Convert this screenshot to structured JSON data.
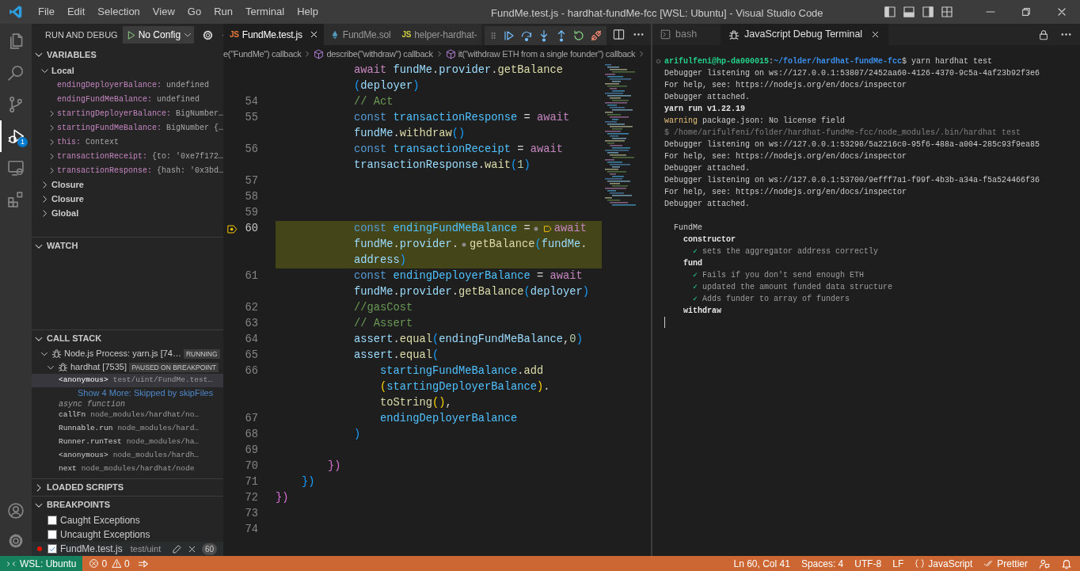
{
  "title_bar": {
    "menus": [
      "File",
      "Edit",
      "Selection",
      "View",
      "Go",
      "Run",
      "Terminal",
      "Help"
    ],
    "title": "FundMe.test.js - hardhat-fundMe-fcc [WSL: Ubuntu] - Visual Studio Code"
  },
  "activity_bar": {
    "items": [
      {
        "kind": "explorer",
        "selected": false
      },
      {
        "kind": "search",
        "selected": false
      },
      {
        "kind": "source-control",
        "selected": false
      },
      {
        "kind": "run-debug",
        "selected": true,
        "badge": "1"
      },
      {
        "kind": "remote",
        "selected": false
      },
      {
        "kind": "extensions",
        "selected": false
      }
    ],
    "bottom": [
      {
        "kind": "account"
      },
      {
        "kind": "settings"
      }
    ]
  },
  "run_and_debug": {
    "title": "RUN AND DEBUG",
    "configuration": "No Config"
  },
  "variables": {
    "title": "VARIABLES",
    "expanded": true,
    "scopes": [
      {
        "label": "Local",
        "expanded": true,
        "children": [
          {
            "name": "endingDeployerBalance:",
            "value": "undefined",
            "expandable": false
          },
          {
            "name": "endingFundMeBalance:",
            "value": "undefined",
            "expandable": false
          },
          {
            "name": "startingDeployerBalance:",
            "value": "BigNumber…",
            "expandable": true
          },
          {
            "name": "startingFundMeBalance:",
            "value": "BigNumber {…",
            "expandable": true
          },
          {
            "name": "this:",
            "value": "Context",
            "expandable": true
          },
          {
            "name": "transactionReceipt:",
            "value": "{to: '0xe7f172…",
            "expandable": true
          },
          {
            "name": "transactionResponse:",
            "value": "{hash: '0x3bd…",
            "expandable": true
          }
        ]
      },
      {
        "label": "Closure",
        "expanded": false
      },
      {
        "label": "Closure",
        "expanded": false
      },
      {
        "label": "Global",
        "expanded": false
      }
    ]
  },
  "watch": {
    "title": "WATCH",
    "expanded": true
  },
  "call_stack": {
    "title": "CALL STACK",
    "expanded": true,
    "sessions": [
      {
        "label": "Node.js Process: yarn.js [74…",
        "badge": "RUNNING",
        "expanded": true,
        "children": [
          {
            "label": "hardhat [7535]",
            "badge": "PAUSED ON BREAKPOINT",
            "expanded": true,
            "frames": [
              {
                "kind": "frame",
                "name": "<anonymous>",
                "source": "test/uint/FundMe.test…",
                "selected": true
              },
              {
                "kind": "link",
                "text": "Show 4 More: Skipped by skipFiles"
              },
              {
                "kind": "label",
                "text": "async function"
              },
              {
                "kind": "frame",
                "name": "callFn",
                "source": "node_modules/hardhat/no…",
                "selected": false
              },
              {
                "kind": "frame",
                "name": "Runnable.run",
                "source": "node_modules/hard…",
                "selected": false
              },
              {
                "kind": "frame",
                "name": "Runner.runTest",
                "source": "node_modules/ha…",
                "selected": false
              },
              {
                "kind": "frame",
                "name": "<anonymous>",
                "source": "node_modules/hardh…",
                "selected": false
              },
              {
                "kind": "frame",
                "name": "next",
                "source": "node_modules/hardhat/node",
                "selected": false
              }
            ]
          }
        ]
      }
    ]
  },
  "loaded_scripts": {
    "title": "LOADED SCRIPTS",
    "expanded": false
  },
  "breakpoints": {
    "title": "BREAKPOINTS",
    "expanded": true,
    "items": [
      {
        "kind": "exception",
        "label": "Caught Exceptions",
        "checked": false
      },
      {
        "kind": "exception",
        "label": "Uncaught Exceptions",
        "checked": false
      },
      {
        "kind": "file",
        "label": "FundMe.test.js",
        "path": "test/uint",
        "checked": true,
        "line": "60"
      }
    ]
  },
  "editor": {
    "tabs": [
      {
        "kind": "js",
        "icon_text": "JS",
        "color": "#e8793a",
        "label": "FundMe.test.js",
        "selected": true
      },
      {
        "kind": "sol",
        "label": "FundMe.sol",
        "selected": false
      },
      {
        "kind": "js",
        "icon_text": "JS",
        "color": "#cbcb41",
        "label": "helper-hardhat-",
        "selected": false
      }
    ],
    "breadcrumb": [
      {
        "text": "e(\"FundMe\") callback",
        "icon": false
      },
      {
        "text": "describe(\"withdraw\") callback",
        "icon": true
      },
      {
        "text": "it(\"withdraw ETH from a single founder\") callback",
        "icon": true
      }
    ],
    "rows": [
      {
        "children": [
          {
            "children": [
              {
                "children": [
                  {
                    "paused": false,
                    "breakpoint": false,
                    "tokens": [
                      {
                        "kind": "ctl",
                        "text": "await "
                      },
                      {
                        "kind": "prop",
                        "text": "fundMe"
                      },
                      {
                        "kind": "p",
                        "text": "."
                      },
                      {
                        "kind": "prop",
                        "text": "provider"
                      },
                      {
                        "kind": "p",
                        "text": "."
                      },
                      {
                        "kind": "fn",
                        "text": "getBalance"
                      }
                    ]
                  },
                  {
                    "paused": false,
                    "breakpoint": false,
                    "tokens": [
                      {
                        "kind": "b3",
                        "text": "("
                      },
                      {
                        "kind": "prop",
                        "text": "deployer"
                      },
                      {
                        "kind": "b3",
                        "text": ")"
                      }
                    ]
                  },
                  {
                    "line": "54",
                    "paused": false,
                    "breakpoint": false,
                    "tokens": [
                      {
                        "kind": "cm",
                        "text": "// Act"
                      }
                    ]
                  },
                  {
                    "line": "55",
                    "paused": false,
                    "breakpoint": false,
                    "tokens": [
                      {
                        "kind": "kw",
                        "text": "const "
                      },
                      {
                        "kind": "var",
                        "text": "transactionResponse"
                      },
                      {
                        "kind": "p",
                        "text": " = "
                      },
                      {
                        "kind": "ctl",
                        "text": "await"
                      }
                    ]
                  },
                  {
                    "paused": false,
                    "breakpoint": false,
                    "tokens": [
                      {
                        "kind": "prop",
                        "text": "fundMe"
                      },
                      {
                        "kind": "p",
                        "text": "."
                      },
                      {
                        "kind": "fn",
                        "text": "withdraw"
                      },
                      {
                        "kind": "b3",
                        "text": "()"
                      }
                    ]
                  },
                  {
                    "line": "56",
                    "paused": false,
                    "breakpoint": false,
                    "tokens": [
                      {
                        "kind": "kw",
                        "text": "const "
                      },
                      {
                        "kind": "var",
                        "text": "transactionReceipt"
                      },
                      {
                        "kind": "p",
                        "text": " = "
                      },
                      {
                        "kind": "ctl",
                        "text": "await"
                      }
                    ]
                  },
                  {
                    "paused": false,
                    "breakpoint": false,
                    "tokens": [
                      {
                        "kind": "prop",
                        "text": "transactionResponse"
                      },
                      {
                        "kind": "p",
                        "text": "."
                      },
                      {
                        "kind": "fn",
                        "text": "wait"
                      },
                      {
                        "kind": "b3",
                        "text": "("
                      },
                      {
                        "kind": "num",
                        "text": "1"
                      },
                      {
                        "kind": "b3",
                        "text": ")"
                      }
                    ]
                  },
                  {
                    "line": "57",
                    "paused": false,
                    "breakpoint": false
                  },
                  {
                    "line": "58",
                    "paused": false,
                    "breakpoint": false
                  },
                  {
                    "line": "59",
                    "paused": false,
                    "breakpoint": false
                  },
                  {
                    "line": "60",
                    "paused": true,
                    "breakpoint": true,
                    "tokens": [
                      {
                        "kind": "kw",
                        "text": "const "
                      },
                      {
                        "kind": "var",
                        "text": "endingFundMeBalance"
                      },
                      {
                        "kind": "p",
                        "text": " ="
                      },
                      {
                        "kind": "bp"
                      },
                      {
                        "kind": "stop"
                      },
                      {
                        "kind": "ctl",
                        "text": "await"
                      }
                    ]
                  },
                  {
                    "paused": true,
                    "breakpoint": false,
                    "tokens": [
                      {
                        "kind": "prop",
                        "text": "fundMe"
                      },
                      {
                        "kind": "p",
                        "text": "."
                      },
                      {
                        "kind": "prop",
                        "text": "provider"
                      },
                      {
                        "kind": "p",
                        "text": "."
                      },
                      {
                        "kind": "bp"
                      },
                      {
                        "kind": "fn",
                        "text": "getBalance"
                      },
                      {
                        "kind": "b3",
                        "text": "("
                      },
                      {
                        "kind": "prop",
                        "text": "fundMe"
                      },
                      {
                        "kind": "p",
                        "text": "."
                      }
                    ]
                  },
                  {
                    "paused": true,
                    "breakpoint": false,
                    "tokens": [
                      {
                        "kind": "prop",
                        "text": "address"
                      },
                      {
                        "kind": "b3",
                        "text": ")"
                      }
                    ]
                  },
                  {
                    "line": "61",
                    "paused": false,
                    "breakpoint": false,
                    "tokens": [
                      {
                        "kind": "kw",
                        "text": "const "
                      },
                      {
                        "kind": "var",
                        "text": "endingDeployerBalance"
                      },
                      {
                        "kind": "p",
                        "text": " = "
                      },
                      {
                        "kind": "ctl",
                        "text": "await"
                      }
                    ]
                  },
                  {
                    "paused": false,
                    "breakpoint": false,
                    "tokens": [
                      {
                        "kind": "prop",
                        "text": "fundMe"
                      },
                      {
                        "kind": "p",
                        "text": "."
                      },
                      {
                        "kind": "prop",
                        "text": "provider"
                      },
                      {
                        "kind": "p",
                        "text": "."
                      },
                      {
                        "kind": "fn",
                        "text": "getBalance"
                      },
                      {
                        "kind": "b3",
                        "text": "("
                      },
                      {
                        "kind": "prop",
                        "text": "deployer"
                      },
                      {
                        "kind": "b3",
                        "text": ")"
                      }
                    ]
                  },
                  {
                    "line": "62",
                    "paused": false,
                    "breakpoint": false,
                    "tokens": [
                      {
                        "kind": "cm",
                        "text": "//gasCost"
                      }
                    ]
                  },
                  {
                    "line": "63",
                    "paused": false,
                    "breakpoint": false,
                    "tokens": [
                      {
                        "kind": "cm",
                        "text": "// Assert"
                      }
                    ]
                  },
                  {
                    "line": "64",
                    "paused": false,
                    "breakpoint": false,
                    "tokens": [
                      {
                        "kind": "prop",
                        "text": "assert"
                      },
                      {
                        "kind": "p",
                        "text": "."
                      },
                      {
                        "kind": "fn",
                        "text": "equal"
                      },
                      {
                        "kind": "b3",
                        "text": "("
                      },
                      {
                        "kind": "prop",
                        "text": "endingFundMeBalance"
                      },
                      {
                        "kind": "p",
                        "text": ","
                      },
                      {
                        "kind": "num",
                        "text": "0"
                      },
                      {
                        "kind": "b3",
                        "text": ")"
                      }
                    ]
                  },
                  {
                    "line": "65",
                    "paused": false,
                    "breakpoint": false,
                    "tokens": [
                      {
                        "kind": "prop",
                        "text": "assert"
                      },
                      {
                        "kind": "p",
                        "text": "."
                      },
                      {
                        "kind": "fn",
                        "text": "equal"
                      },
                      {
                        "kind": "b3",
                        "text": "("
                      }
                    ],
                    "children": [
                      {
                        "line": "66",
                        "paused": false,
                        "breakpoint": false,
                        "tokens": [
                          {
                            "kind": "var",
                            "text": "startingFundMeBalance"
                          },
                          {
                            "kind": "p",
                            "text": "."
                          },
                          {
                            "kind": "fn",
                            "text": "add"
                          }
                        ]
                      },
                      {
                        "paused": false,
                        "breakpoint": false,
                        "tokens": [
                          {
                            "kind": "b1",
                            "text": "("
                          },
                          {
                            "kind": "var",
                            "text": "startingDeployerBalance"
                          },
                          {
                            "kind": "b1",
                            "text": ")"
                          },
                          {
                            "kind": "p",
                            "text": "."
                          }
                        ]
                      },
                      {
                        "paused": false,
                        "breakpoint": false,
                        "tokens": [
                          {
                            "kind": "fn",
                            "text": "toString"
                          },
                          {
                            "kind": "b1",
                            "text": "()"
                          },
                          {
                            "kind": "p",
                            "text": ","
                          }
                        ]
                      },
                      {
                        "line": "67",
                        "paused": false,
                        "breakpoint": false,
                        "tokens": [
                          {
                            "kind": "var",
                            "text": "endingDeployerBalance"
                          }
                        ]
                      }
                    ]
                  },
                  {
                    "line": "68",
                    "paused": false,
                    "breakpoint": false,
                    "tokens": [
                      {
                        "kind": "b3",
                        "text": ")"
                      }
                    ]
                  },
                  {
                    "line": "69",
                    "paused": false,
                    "breakpoint": false
                  }
                ]
              },
              {
                "line": "70",
                "paused": false,
                "breakpoint": false,
                "tokens": [
                  {
                    "kind": "b2",
                    "text": "}"
                  },
                  {
                    "kind": "b2",
                    "text": ")"
                  }
                ]
              }
            ]
          },
          {
            "line": "71",
            "paused": false,
            "breakpoint": false,
            "tokens": [
              {
                "kind": "b3",
                "text": "}"
              },
              {
                "kind": "b3",
                "text": ")"
              }
            ]
          }
        ]
      },
      {
        "line": "72",
        "paused": false,
        "breakpoint": false,
        "tokens": [
          {
            "kind": "b2",
            "text": "}"
          },
          {
            "kind": "b2",
            "text": ")"
          }
        ]
      },
      {
        "line": "73",
        "paused": false,
        "breakpoint": false
      },
      {
        "line": "74",
        "paused": false,
        "breakpoint": false
      }
    ]
  },
  "terminal": {
    "tabs": [
      {
        "kind": "shell",
        "label": "bash",
        "selected": false
      },
      {
        "kind": "debug",
        "label": "JavaScript Debug Terminal",
        "selected": true
      }
    ],
    "lines": [
      {
        "tokens": [
          {
            "kind": "marker"
          },
          {
            "kind": "user",
            "text": "arifulfeni@hp-da000015"
          },
          {
            "kind": "plain",
            "text": ":"
          },
          {
            "kind": "path",
            "text": "~/folder/hardhat-fundMe-fcc"
          },
          {
            "kind": "plain",
            "text": "$ yarn hardhat test"
          }
        ]
      },
      {
        "tokens": [
          {
            "kind": "plain",
            "text": "Debugger listening on ws://127.0.0.1:53807/2452aa60-4126-4370-9c5a-4af23b92f3e6"
          }
        ]
      },
      {
        "tokens": [
          {
            "kind": "plain",
            "text": "For help, see: https://nodejs.org/en/docs/inspector"
          }
        ]
      },
      {
        "tokens": [
          {
            "kind": "plain",
            "text": "Debugger attached."
          }
        ]
      },
      {
        "tokens": [
          {
            "kind": "bold",
            "text": "yarn run v1.22.19"
          }
        ]
      },
      {
        "tokens": [
          {
            "kind": "warn",
            "text": "warning"
          },
          {
            "kind": "plain",
            "text": " package.json: No license field"
          }
        ]
      },
      {
        "tokens": [
          {
            "kind": "dim",
            "text": "$ /home/arifulfeni/folder/hardhat-fundMe-fcc/node_modules/.bin/hardhat test"
          }
        ]
      },
      {
        "tokens": [
          {
            "kind": "plain",
            "text": "Debugger listening on ws://127.0.0.1:53298/5a2216c0-95f6-488a-a004-285c93f9ea85"
          }
        ]
      },
      {
        "tokens": [
          {
            "kind": "plain",
            "text": "For help, see: https://nodejs.org/en/docs/inspector"
          }
        ]
      },
      {
        "tokens": [
          {
            "kind": "plain",
            "text": "Debugger attached."
          }
        ]
      },
      {
        "tokens": [
          {
            "kind": "plain",
            "text": "Debugger listening on ws://127.0.0.1:53700/9efff7a1-f99f-4b3b-a34a-f5a524466f36"
          }
        ]
      },
      {
        "tokens": [
          {
            "kind": "plain",
            "text": "For help, see: https://nodejs.org/en/docs/inspector"
          }
        ]
      },
      {
        "tokens": [
          {
            "kind": "plain",
            "text": "Debugger attached."
          }
        ]
      },
      {
        "kind": "blank"
      },
      {
        "tokens": [
          {
            "kind": "plain",
            "text": "  FundMe"
          }
        ]
      },
      {
        "tokens": [
          {
            "kind": "bold",
            "text": "    constructor"
          }
        ]
      },
      {
        "tokens": [
          {
            "kind": "check",
            "text": "      ✓"
          },
          {
            "kind": "pass",
            "text": " sets the aggregator address correctly"
          }
        ]
      },
      {
        "tokens": [
          {
            "kind": "bold",
            "text": "    fund"
          }
        ]
      },
      {
        "tokens": [
          {
            "kind": "check",
            "text": "      ✓"
          },
          {
            "kind": "pass",
            "text": " Fails if you don't send enough ETH"
          }
        ]
      },
      {
        "tokens": [
          {
            "kind": "check",
            "text": "      ✓"
          },
          {
            "kind": "pass",
            "text": " updated the amount funded data structure"
          }
        ]
      },
      {
        "tokens": [
          {
            "kind": "check",
            "text": "      ✓"
          },
          {
            "kind": "pass",
            "text": " Adds funder to array of funders"
          }
        ]
      },
      {
        "tokens": [
          {
            "kind": "bold",
            "text": "    withdraw"
          }
        ]
      }
    ]
  },
  "status_bar": {
    "remote": "WSL: Ubuntu",
    "errors": "0",
    "warnings": "0",
    "items": [
      {
        "kind": "text",
        "text": "Ln 60, Col 41"
      },
      {
        "kind": "text",
        "text": "Spaces: 4"
      },
      {
        "kind": "text",
        "text": "UTF-8"
      },
      {
        "kind": "text",
        "text": "LF"
      },
      {
        "kind": "language",
        "text": "JavaScript"
      },
      {
        "kind": "formatter",
        "text": "Prettier"
      },
      {
        "kind": "feedback"
      },
      {
        "kind": "notifications"
      }
    ]
  }
}
